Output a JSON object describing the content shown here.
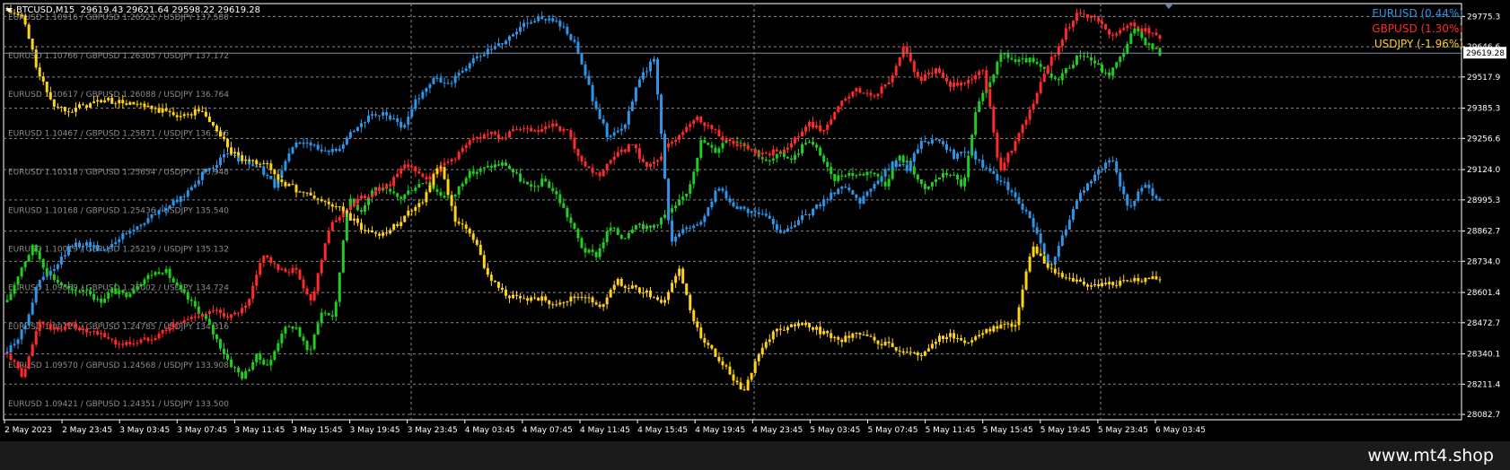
{
  "header": {
    "symbol": "BTCUSD,M15",
    "ohlc": "29619.43 29621.64 29598.22 29619.28"
  },
  "footer": {
    "site": "www.mt4.shop"
  },
  "colors": {
    "background": "#000000",
    "grid": "#8a8a8a",
    "axis_text": "#ffffff",
    "EURUSD": "#2f95e8",
    "GBPUSD": "#ff2b2b",
    "USDJPY": "#ffd21c",
    "BTCUSD": "#22cc22"
  },
  "chart_data": {
    "type": "line",
    "title": "BTCUSD,M15",
    "x_labels": [
      "2 May 2023",
      "2 May 23:45",
      "3 May 03:45",
      "3 May 07:45",
      "3 May 11:45",
      "3 May 15:45",
      "3 May 19:45",
      "3 May 23:45",
      "4 May 03:45",
      "4 May 07:45",
      "4 May 11:45",
      "4 May 15:45",
      "4 May 19:45",
      "4 May 23:45",
      "5 May 03:45",
      "5 May 07:45",
      "5 May 11:45",
      "5 May 15:45",
      "5 May 19:45",
      "5 May 23:45",
      "6 May 03:45"
    ],
    "y_ticks": [
      29775.3,
      29646.6,
      29517.9,
      29385.3,
      29256.6,
      29124.0,
      28995.3,
      28862.7,
      28734.0,
      28601.4,
      28472.7,
      28340.1,
      28211.4,
      28082.7
    ],
    "ylim": [
      28060,
      29830
    ],
    "current_price": "29619.28",
    "overlay_levels": [
      "EURUSD 1.10916 / GBPUSD 1.26522 / USDJPY 137.580",
      "EURUSD 1.10766 / GBPUSD 1.26305 / USDJPY 137.172",
      "EURUSD 1.10617 / GBPUSD 1.26088 / USDJPY 136.764",
      "EURUSD 1.10467 / GBPUSD 1.25871 / USDJPY 136.356",
      "EURUSD 1.10318 / GBPUSD 1.25654 / USDJPY 135.948",
      "EURUSD 1.10168 / GBPUSD 1.25436 / USDJPY 135.540",
      "EURUSD 1.10019 / GBPUSD 1.25219 / USDJPY 135.132",
      "EURUSD 1.09869 / GBPUSD 1.25002 / USDJPY 134.724",
      "EURUSD 1.09720 / GBPUSD 1.24785 / USDJPY 134.316",
      "EURUSD 1.09570 / GBPUSD 1.24568 / USDJPY 133.908",
      "EURUSD 1.09421 / GBPUSD 1.24351 / USDJPY 133.500"
    ],
    "legend": [
      {
        "label": "EURUSD (0.44%)",
        "color": "#2f95e8"
      },
      {
        "label": "GBPUSD (1.30%)",
        "color": "#ff2b2b"
      },
      {
        "label": "USDJPY (-1.96%)",
        "color": "#ffd21c"
      }
    ],
    "series": [
      {
        "color": "#22cc22",
        "values": [
          28560,
          28700,
          28800,
          28690,
          28640,
          28600,
          28620,
          28560,
          28610,
          28590,
          28640,
          28680,
          28700,
          28620,
          28560,
          28500,
          28400,
          28300,
          28240,
          28330,
          28290,
          28440,
          28460,
          28340,
          28520,
          28500,
          29000,
          28950,
          29050,
          29030,
          29000,
          29050,
          29080,
          29020,
          29000,
          29100,
          29120,
          29140,
          29150,
          29090,
          29040,
          29080,
          29010,
          28900,
          28780,
          28760,
          28880,
          28830,
          28900,
          28870,
          28920,
          28960,
          29040,
          29250,
          29200,
          29260,
          29240,
          29210,
          29150,
          29190,
          29170,
          29250,
          29200,
          29080,
          29110,
          29100,
          29120,
          29060,
          29180,
          29140,
          29030,
          29090,
          29110,
          29050,
          29380,
          29500,
          29620,
          29580,
          29590,
          29550,
          29500,
          29560,
          29620,
          29580,
          29520,
          29600,
          29720,
          29660,
          29619
        ]
      },
      {
        "color": "#ff2b2b",
        "values": [
          28350,
          28240,
          28480,
          28440,
          28470,
          28430,
          28420,
          28380,
          28390,
          28410,
          28450,
          28480,
          28510,
          28520,
          28500,
          28540,
          28770,
          28690,
          28700,
          28560,
          28860,
          28950,
          29000,
          29030,
          29070,
          29150,
          29080,
          29130,
          29180,
          29250,
          29280,
          29260,
          29300,
          29280,
          29310,
          29280,
          29130,
          29100,
          29180,
          29230,
          29130,
          29200,
          29280,
          29350,
          29300,
          29240,
          29220,
          29180,
          29200,
          29230,
          29320,
          29290,
          29400,
          29460,
          29440,
          29480,
          29650,
          29500,
          29550,
          29480,
          29500,
          29550,
          29120,
          29250,
          29400,
          29560,
          29700,
          29800,
          29760,
          29700,
          29740,
          29720,
          29680
        ]
      },
      {
        "color": "#2f95e8",
        "values": [
          28350,
          28440,
          28650,
          28700,
          28800,
          28810,
          28780,
          28830,
          28870,
          28920,
          28960,
          29000,
          29080,
          29140,
          29190,
          29160,
          29130,
          29050,
          29220,
          29250,
          29190,
          29220,
          29300,
          29350,
          29360,
          29300,
          29430,
          29510,
          29490,
          29560,
          29610,
          29650,
          29700,
          29760,
          29770,
          29740,
          29650,
          29440,
          29270,
          29300,
          29500,
          29600,
          28820,
          28880,
          28900,
          29060,
          28960,
          28950,
          28930,
          28860,
          28900,
          28950,
          29010,
          29060,
          28990,
          29060,
          29150,
          29130,
          29250,
          29240,
          29180,
          29200,
          29130,
          29070,
          29000,
          28880,
          28700,
          28870,
          29020,
          29120,
          29160,
          28960,
          29060,
          28980
        ]
      },
      {
        "color": "#ffd21c",
        "values": [
          29800,
          29770,
          29520,
          29390,
          29380,
          29400,
          29420,
          29410,
          29400,
          29380,
          29370,
          29350,
          29380,
          29300,
          29200,
          29150,
          29160,
          29080,
          29040,
          29010,
          28980,
          28950,
          28880,
          28850,
          28870,
          28940,
          29000,
          29150,
          28900,
          28850,
          28680,
          28600,
          28570,
          28580,
          28560,
          28570,
          28590,
          28530,
          28650,
          28620,
          28600,
          28560,
          28700,
          28450,
          28360,
          28270,
          28180,
          28360,
          28440,
          28460,
          28460,
          28430,
          28400,
          28420,
          28400,
          28380,
          28350,
          28330,
          28400,
          28420,
          28390,
          28430,
          28460,
          28470,
          28800,
          28700,
          28670,
          28640,
          28630,
          28640,
          28650,
          28660,
          28660
        ]
      }
    ]
  }
}
